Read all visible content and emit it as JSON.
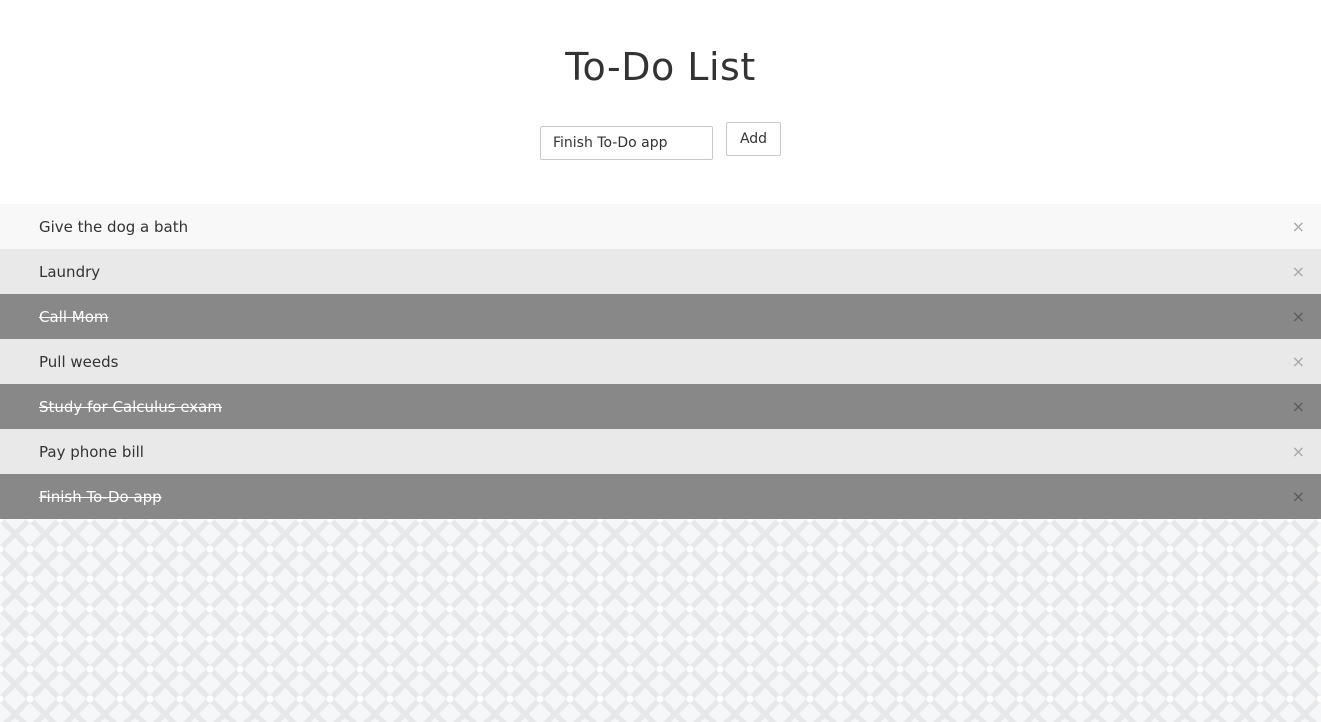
{
  "app": {
    "title": "To-Do List"
  },
  "form": {
    "input_value": "Finish To-Do app",
    "add_label": "Add"
  },
  "todos": [
    {
      "text": "Give the dog a bath",
      "done": false
    },
    {
      "text": "Laundry",
      "done": false
    },
    {
      "text": "Call Mom",
      "done": true
    },
    {
      "text": "Pull weeds",
      "done": false
    },
    {
      "text": "Study for Calculus exam",
      "done": true
    },
    {
      "text": "Pay phone bill",
      "done": false
    },
    {
      "text": "Finish To-Do app",
      "done": true
    }
  ],
  "close_glyph": "×",
  "colors": {
    "done_bg": "#888888",
    "row_alt_bg": "#e9e9e9",
    "row_first_bg": "#f8f8f8"
  }
}
